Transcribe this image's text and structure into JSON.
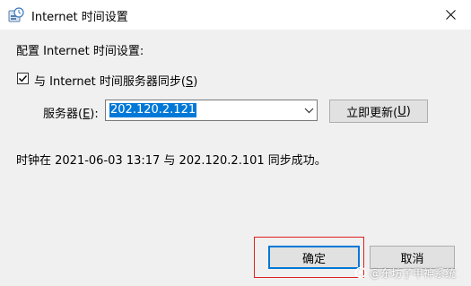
{
  "window": {
    "title": "Internet 时间设置",
    "icon": "clock-globe-icon"
  },
  "section_label": "配置 Internet 时间设置:",
  "sync_checkbox": {
    "checked": true,
    "label_text": "与 Internet 时间服务器同步(",
    "label_accel": "S",
    "label_end": ")"
  },
  "server": {
    "label_text": "服务器(",
    "label_accel": "E",
    "label_end": "):",
    "value": "202.120.2.121"
  },
  "update_button": {
    "text": "立即更新(",
    "accel": "U",
    "end": ")"
  },
  "status_text": "时钟在 2021-06-03 13:17 与 202.120.2.101 同步成功。",
  "buttons": {
    "ok": "确定",
    "cancel": "取消"
  },
  "watermark": "@东坊子甲神系统",
  "colors": {
    "selection": "#0078d7",
    "highlight_box": "#e02020",
    "dialog_bg": "#f0f0f0"
  }
}
